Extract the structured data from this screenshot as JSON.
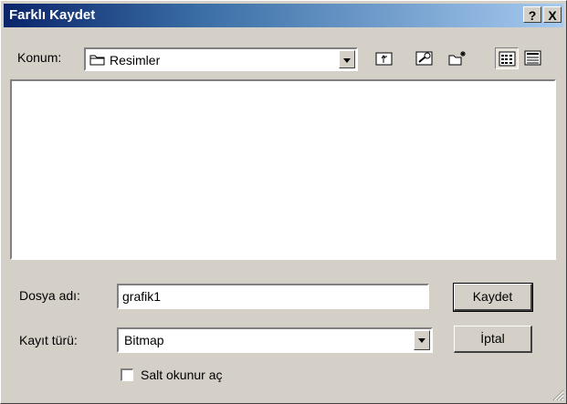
{
  "window": {
    "title": "Farklı Kaydet",
    "help_button": "?",
    "close_button": "X"
  },
  "location": {
    "label": "Konum:",
    "value": "Resimler",
    "folder_icon": "folder-icon"
  },
  "toolbar": {
    "up_icon": "up-one-level-icon",
    "favorites_icon": "desktop-icon",
    "new_folder_icon": "new-folder-icon",
    "list_view_icon": "list-view-icon",
    "details_view_icon": "details-view-icon"
  },
  "filename": {
    "label": "Dosya adı:",
    "value": "grafik1"
  },
  "filetype": {
    "label": "Kayıt türü:",
    "value": "Bitmap"
  },
  "readonly": {
    "label": "Salt okunur aç",
    "checked": false
  },
  "buttons": {
    "save": "Kaydet",
    "cancel": "İptal"
  }
}
